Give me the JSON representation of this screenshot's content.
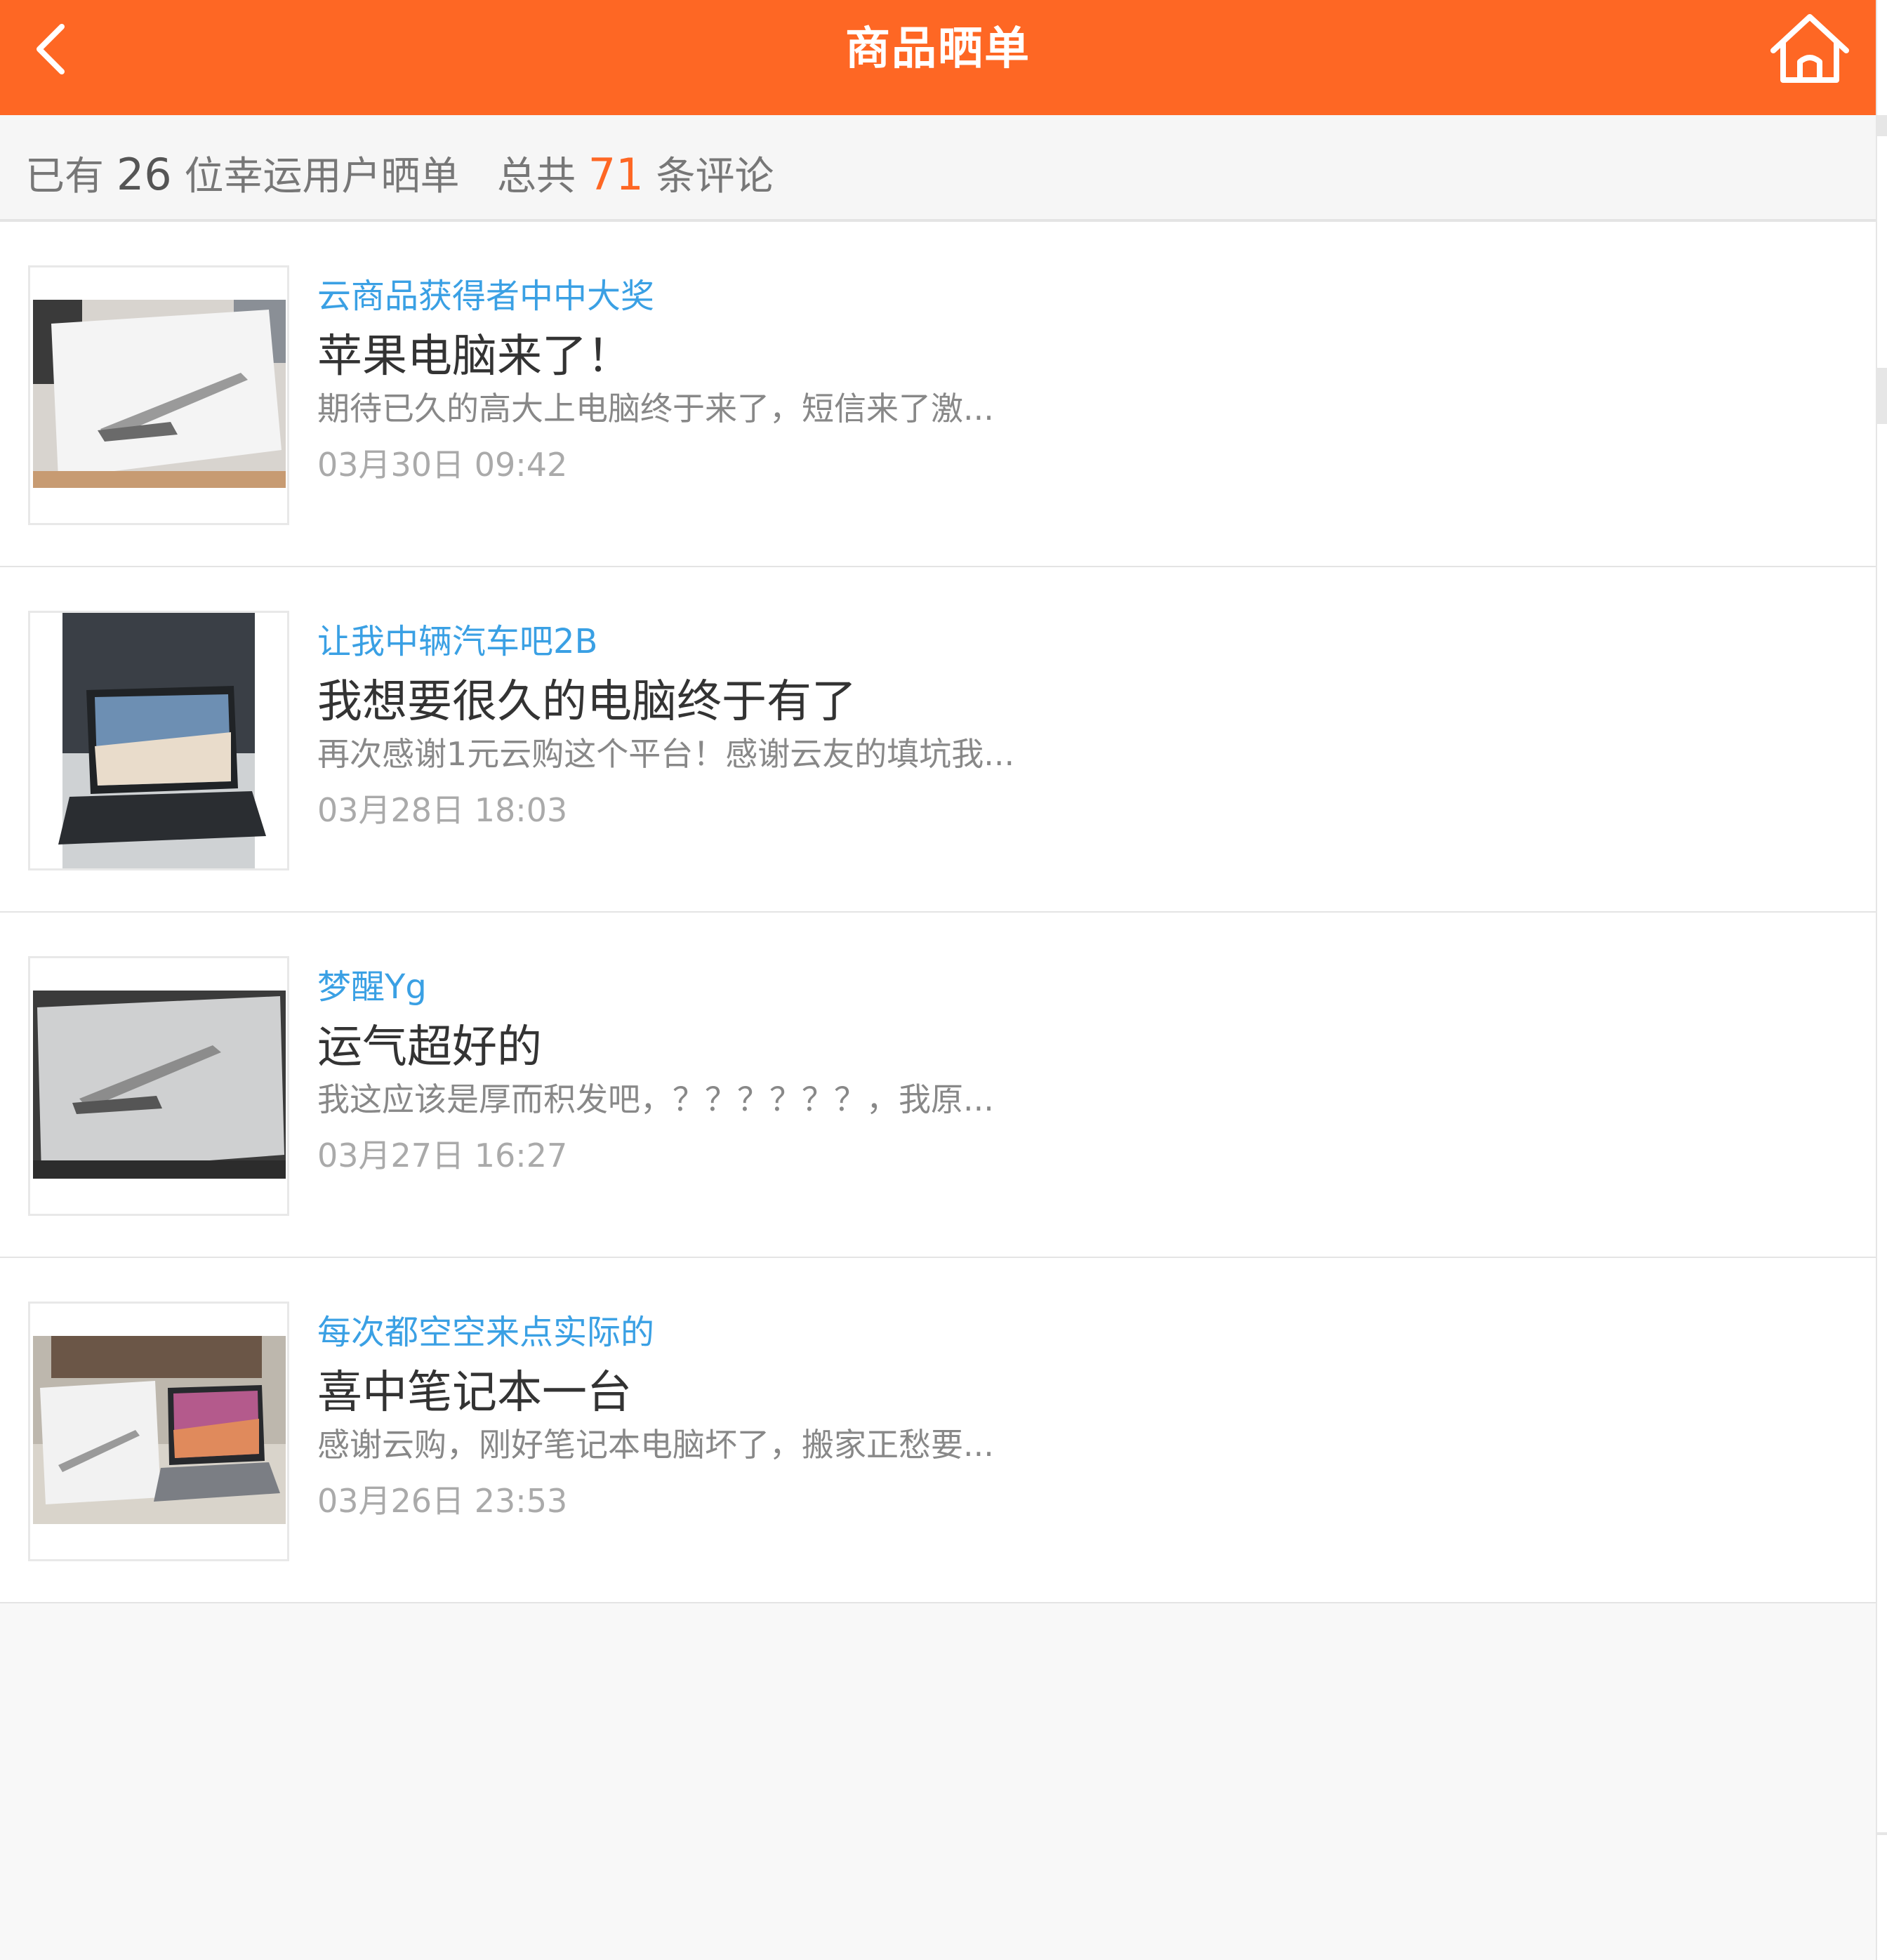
{
  "header": {
    "title": "商品晒单",
    "back_icon": "chevron-left-icon",
    "home_icon": "home-icon",
    "background_color": "#fe6724"
  },
  "summary": {
    "prefix": "已有",
    "user_count": "26",
    "users_suffix": "位幸运用户晒单",
    "total_prefix": "总共",
    "comment_count": "71",
    "comment_suffix": "条评论",
    "accent_color": "#fe6724"
  },
  "posts": [
    {
      "author": "云商品获得者中中大奖",
      "title": "苹果电脑来了！",
      "excerpt": "期待已久的高大上电脑终于来了，短信来了激...",
      "date": "03月30日 09:42",
      "image": "laptop-box-photo"
    },
    {
      "author": "让我中辆汽车吧2B",
      "title": "我想要很久的电脑终于有了",
      "excerpt": "再次感谢1元云购这个平台！感谢云友的填坑我...",
      "date": "03月28日 18:03",
      "image": "open-laptop-photo"
    },
    {
      "author": "梦醒Yg",
      "title": "运气超好的",
      "excerpt": "我这应该是厚而积发吧，？？？？？？，我原...",
      "date": "03月27日 16:27",
      "image": "laptop-box-photo"
    },
    {
      "author": "每次都空空来点实际的",
      "title": "喜中笔记本一台",
      "excerpt": "感谢云购，刚好笔记本电脑坏了，搬家正愁要...",
      "date": "03月26日 23:53",
      "image": "laptop-and-box-photo"
    }
  ],
  "colors": {
    "author": "#3aa0e4",
    "title": "#333333",
    "excerpt": "#888888",
    "date": "#aaaaaa"
  }
}
